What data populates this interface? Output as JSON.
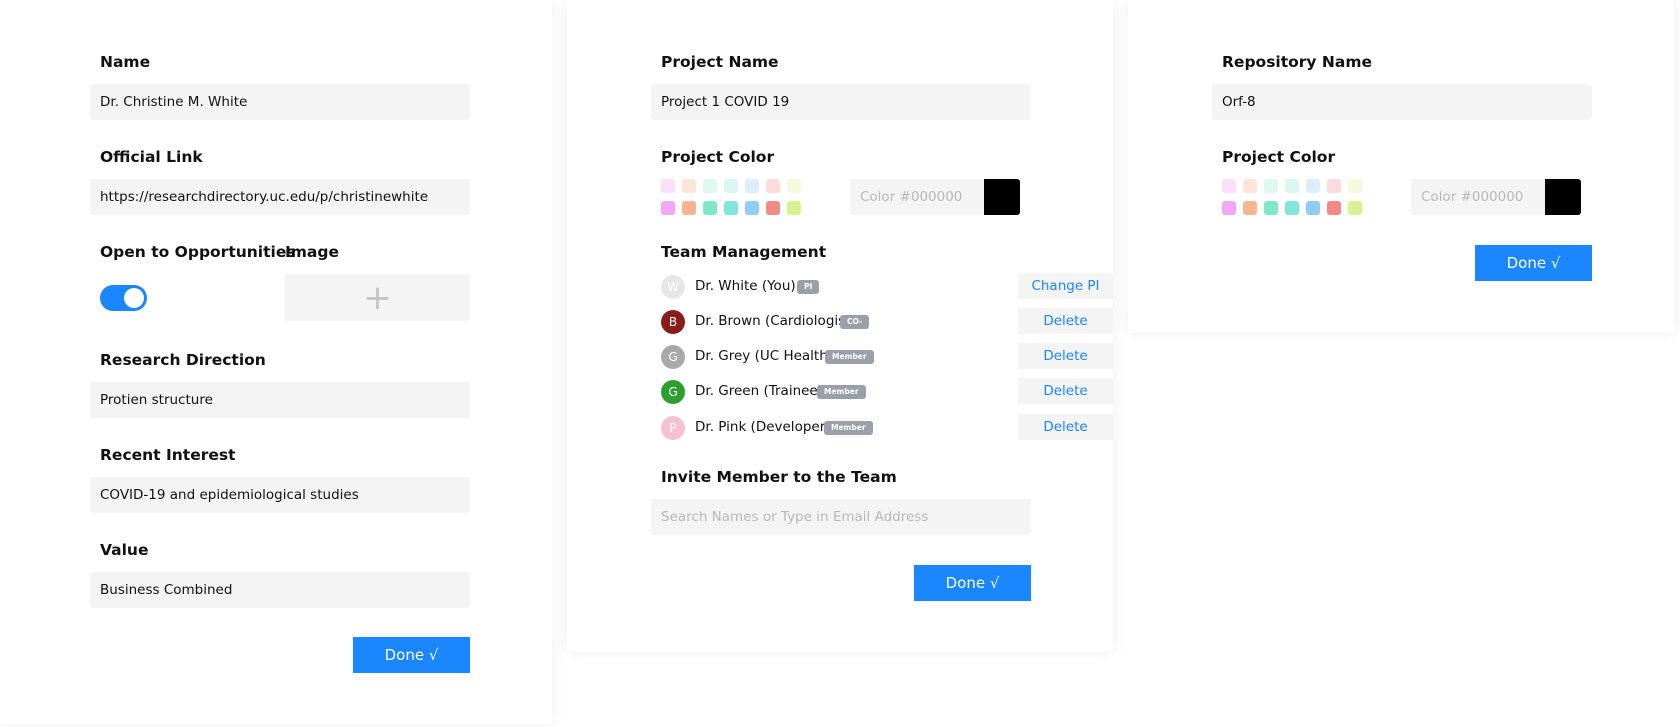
{
  "profile": {
    "name_label": "Name",
    "name_value": "Dr. Christine M. White",
    "link_label": "Official Link",
    "link_value": "https://researchdirectory.uc.edu/p/christinewhite",
    "opportunities_label": "Open to Opportunities",
    "opportunities_on": true,
    "image_label": "Image",
    "image_add_glyph": "+",
    "research_label": "Research Direction",
    "research_value": "Protien structure",
    "interest_label": "Recent Interest",
    "interest_value": "COVID-19 and epidemiological studies",
    "value_label": "Value",
    "value_value": "Business Combined",
    "done_label": "Done √"
  },
  "project": {
    "name_label": "Project Name",
    "name_value": "Project 1 COVID 19",
    "color_label": "Project Color",
    "color_placeholder": "Color #000000",
    "selected_color": "#000000",
    "swatch_colors_light": [
      "#fbe0fb",
      "#fde5d8",
      "#dcf8ef",
      "#dcf7f2",
      "#dceefb",
      "#fbdcdc",
      "#f2fbdc"
    ],
    "swatch_colors_dark": [
      "#f3a6f5",
      "#f8b58f",
      "#7fe8c8",
      "#7fe6d8",
      "#8fcdf7",
      "#f38a8a",
      "#d6f38f"
    ],
    "team_label": "Team Management",
    "members": [
      {
        "initial": "W",
        "name": "Dr. White (You)",
        "role": "PI",
        "action": "Change PI",
        "avatar_color": "#e6e6e6"
      },
      {
        "initial": "B",
        "name": "Dr. Brown (Cardiologist)",
        "role": "CO-PI",
        "action": "Delete",
        "avatar_color": "#8b1c1c"
      },
      {
        "initial": "G",
        "name": "Dr. Grey (UC Health)",
        "role": "Member",
        "action": "Delete",
        "avatar_color": "#a9a9a9"
      },
      {
        "initial": "G",
        "name": "Dr. Green (Trainee)",
        "role": "Member",
        "action": "Delete",
        "avatar_color": "#2e9e2e"
      },
      {
        "initial": "P",
        "name": "Dr. Pink (Developer)",
        "role": "Member",
        "action": "Delete",
        "avatar_color": "#f7c1d4"
      }
    ],
    "invite_label": "Invite Member to the Team",
    "invite_placeholder": "Search Names or Type in Email Address",
    "done_label": "Done √"
  },
  "repository": {
    "name_label": "Repository Name",
    "name_value": "Orf-8",
    "color_label": "Project Color",
    "color_placeholder": "Color #000000",
    "selected_color": "#000000",
    "done_label": "Done √"
  },
  "colors": {
    "accent": "#1a86ff",
    "field_bg": "#f4f4f4",
    "badge_bg": "#9aa0aa"
  }
}
